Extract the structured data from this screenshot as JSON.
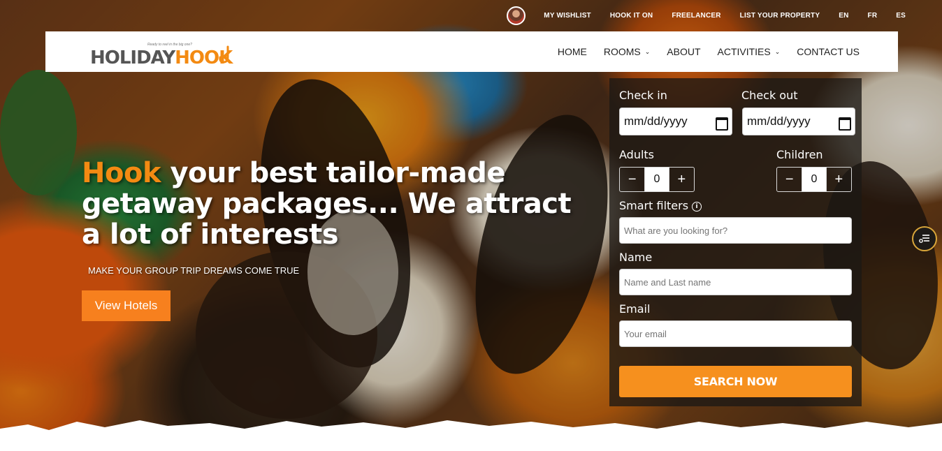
{
  "topbar": {
    "links": [
      "MY WISHLIST",
      "HOOK IT ON",
      "FREELANCER",
      "LIST YOUR PROPERTY",
      "EN",
      "FR",
      "ES"
    ]
  },
  "logo": {
    "tagline": "Ready to reel in the big one?",
    "word_a": "HOLIDAY",
    "word_b": "HOOK"
  },
  "nav": {
    "home": "HOME",
    "rooms": "ROOMS",
    "about": "ABOUT",
    "activities": "ACTIVITIES",
    "contact": "CONTACT US"
  },
  "hero": {
    "title_accent": "Hook",
    "title_rest": " your best tailor-made getaway packages... We attract a lot of interests",
    "subtitle": "MAKE YOUR GROUP TRIP DREAMS COME TRUE",
    "cta": "View Hotels"
  },
  "search": {
    "checkin_label": "Check in",
    "checkout_label": "Check out",
    "date_placeholder": "mm/dd/yyyy",
    "adults_label": "Adults",
    "children_label": "Children",
    "adults_value": "0",
    "children_value": "0",
    "minus": "−",
    "plus": "+",
    "smart_filters_label": "Smart filters",
    "smart_filters_placeholder": "What are you looking for?",
    "name_label": "Name",
    "name_placeholder": "Name and Last name",
    "email_label": "Email",
    "email_placeholder": "Your email",
    "submit": "SEARCH NOW"
  },
  "icons": {
    "calendar": "calendar-icon",
    "info": "info-icon",
    "chevron": "chevron-down-icon",
    "filter": "filter-icon"
  },
  "colors": {
    "accent": "#f38a12",
    "button": "#f6901e"
  }
}
